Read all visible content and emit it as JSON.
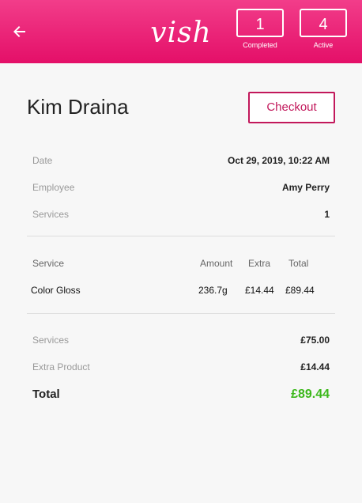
{
  "header": {
    "back_icon": "arrow-left-icon",
    "logo": "vish",
    "stats": [
      {
        "value": "1",
        "label": "Completed"
      },
      {
        "value": "4",
        "label": "Active"
      }
    ],
    "accent": "#e8196f"
  },
  "client": {
    "name": "Kim Draina"
  },
  "checkout": {
    "label": "Checkout"
  },
  "details": [
    {
      "label": "Date",
      "value": "Oct 29, 2019, 10:22 AM"
    },
    {
      "label": "Employee",
      "value": "Amy Perry"
    },
    {
      "label": "Services",
      "value": "1"
    }
  ],
  "service_table": {
    "headers": [
      "Service",
      "Amount",
      "Extra",
      "Total"
    ],
    "rows": [
      {
        "service": "Color Gloss",
        "amount": "236.7g",
        "extra": "£14.44",
        "total": "£89.44"
      }
    ]
  },
  "summary": [
    {
      "label": "Services",
      "value": "£75.00"
    },
    {
      "label": "Extra Product",
      "value": "£14.44"
    }
  ],
  "total": {
    "label": "Total",
    "value": "£89.44",
    "color": "#3cb81b"
  }
}
